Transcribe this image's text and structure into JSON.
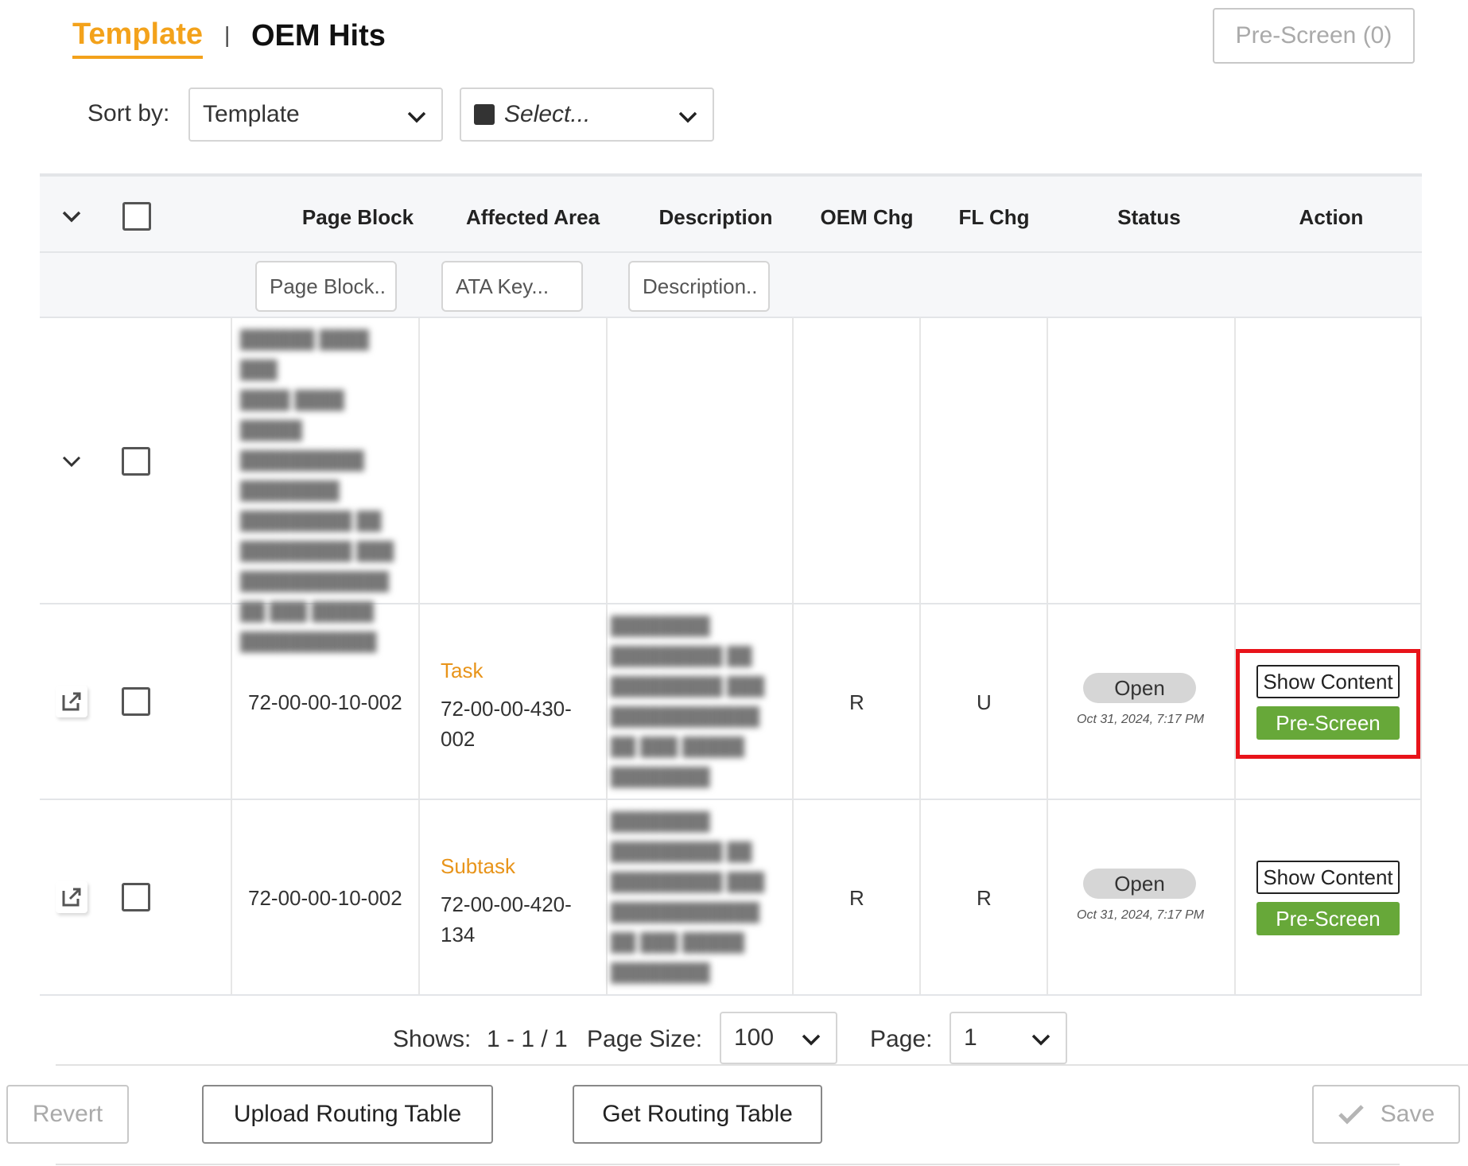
{
  "tabs": {
    "template": "Template",
    "separator": "|",
    "oem_hits": "OEM Hits"
  },
  "prescreen_top": "Pre-Screen (0)",
  "sort": {
    "label": "Sort by:",
    "value": "Template",
    "filter_placeholder": "Select..."
  },
  "table": {
    "headers": {
      "page_block": "Page Block",
      "affected_area": "Affected Area",
      "description": "Description",
      "oem_chg": "OEM Chg",
      "fl_chg": "FL Chg",
      "status": "Status",
      "action": "Action"
    },
    "filters": {
      "page_block": "Page Block..",
      "ata_key": "ATA Key...",
      "description": "Description.."
    },
    "rows": [
      {
        "page_block": "72-00-00-10-002",
        "area_type": "Task",
        "area_code": "72-00-00-430-002",
        "oem_chg": "R",
        "fl_chg": "U",
        "status": "Open",
        "date": "Oct 31, 2024, 7:17 PM",
        "show_content": "Show Content",
        "pre_screen": "Pre-Screen"
      },
      {
        "page_block": "72-00-00-10-002",
        "area_type": "Subtask",
        "area_code": "72-00-00-420-134",
        "oem_chg": "R",
        "fl_chg": "R",
        "status": "Open",
        "date": "Oct 31, 2024, 7:17 PM",
        "show_content": "Show Content",
        "pre_screen": "Pre-Screen"
      }
    ]
  },
  "pager": {
    "shows_label": "Shows:",
    "shows_value": "1 - 1 / 1",
    "page_size_label": "Page Size:",
    "page_size": "100",
    "page_label": "Page:",
    "page": "1"
  },
  "buttons": {
    "revert": "Revert",
    "upload": "Upload Routing Table",
    "get": "Get Routing Table",
    "save": "Save"
  },
  "colors": {
    "accent": "#f3a21b",
    "pre_screen_green": "#67a839",
    "highlight_red": "#e8131a"
  }
}
